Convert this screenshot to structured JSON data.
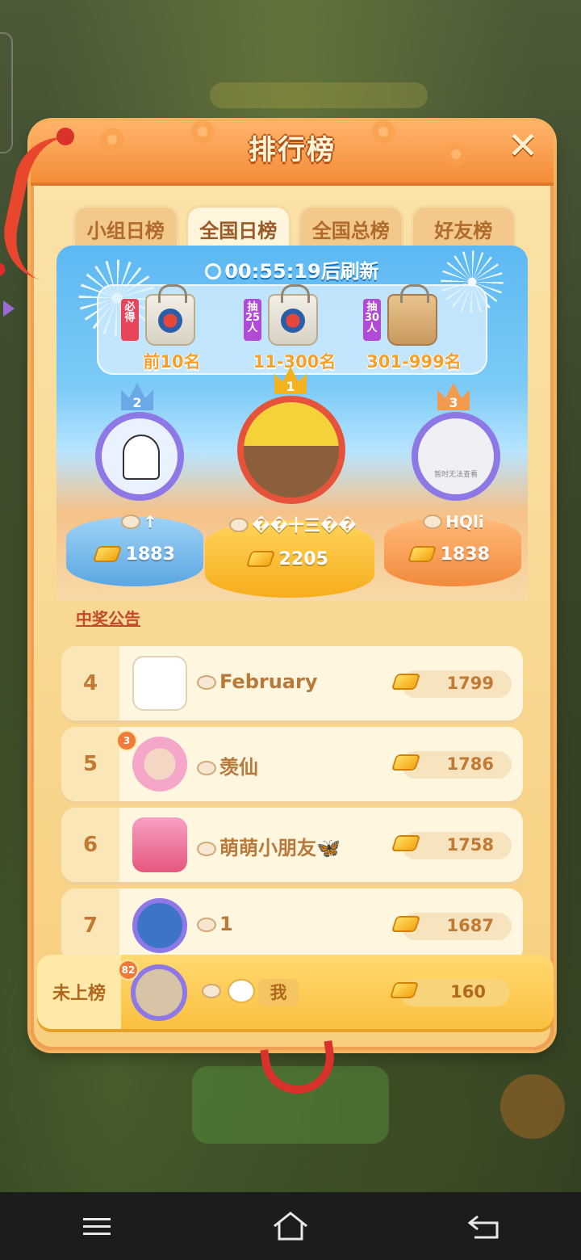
{
  "title": "排行榜",
  "tabs": [
    {
      "label": "小组日榜",
      "active": false
    },
    {
      "label": "全国日榜",
      "active": true
    },
    {
      "label": "全国总榜",
      "active": false
    },
    {
      "label": "好友榜",
      "active": false
    }
  ],
  "timer": "00:55:19后刷新",
  "prizes": [
    {
      "tag": "必得",
      "tag_color": "#e6455a",
      "label": "前10名"
    },
    {
      "tag": "抽25人",
      "tag_color": "#b24ad8",
      "label": "11-300名"
    },
    {
      "tag": "抽30人",
      "tag_color": "#b24ad8",
      "label": "301-999名"
    }
  ],
  "podium": {
    "first": {
      "rank": "1",
      "name": "��十三��",
      "score": "2205"
    },
    "second": {
      "rank": "2",
      "name": "↑",
      "score": "1883"
    },
    "third": {
      "rank": "3",
      "name": "HQli",
      "score": "1838",
      "avatar_note": "暂时无法查看"
    }
  },
  "notice": "中奖公告",
  "rows": [
    {
      "rank": "4",
      "name": "February",
      "score": "1799"
    },
    {
      "rank": "5",
      "name": "羡仙",
      "score": "1786",
      "level": "3"
    },
    {
      "rank": "6",
      "name": "萌萌小朋友🦋",
      "score": "1758"
    },
    {
      "rank": "7",
      "name": "1",
      "score": "1687"
    }
  ],
  "me": {
    "rank": "未上榜",
    "level": "82",
    "tag": "我",
    "score": "160"
  },
  "icons": {
    "close": "close-icon",
    "clock": "clock-icon",
    "gold": "gold-bar-icon",
    "paw": "paw-icon",
    "nav_menu": "menu-icon",
    "nav_home": "home-icon",
    "nav_back": "back-icon"
  },
  "colors": {
    "panel": "#fbe3a9",
    "header": "#f48c37",
    "accent_blue": "#5db8f2",
    "gold": "#f3a411"
  }
}
